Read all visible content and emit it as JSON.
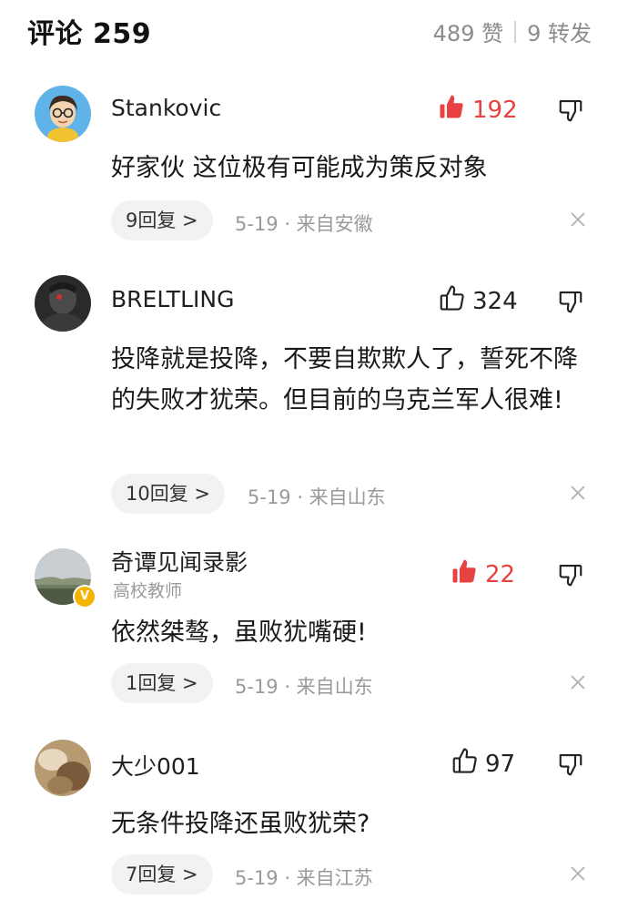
{
  "header": {
    "title": "评论 259",
    "likes": "489 赞",
    "forwards": "9 转发"
  },
  "colors": {
    "liked": "#e84142",
    "muted": "#9a9a9a",
    "pill_bg": "#f2f2f2",
    "verified_badge": "#f5b400"
  },
  "comments": [
    {
      "username": "Stankovic",
      "subtitle": "",
      "liked": true,
      "like_count": "192",
      "text": "好家伙 这位极有可能成为策反对象",
      "replies": "9回复 >",
      "meta": "5-19 · 来自安徽",
      "avatar_icon": "cartoon-avatar-icon"
    },
    {
      "username": "BRELTLING",
      "subtitle": "",
      "liked": false,
      "like_count": "324",
      "text": "投降就是投降，不要自欺欺人了，誓死不降的失败才犹荣。但目前的乌克兰军人很难!",
      "replies": "10回复 >",
      "meta": "5-19 · 来自山东",
      "avatar_icon": "dark-figure-avatar-icon"
    },
    {
      "username": "奇谭见闻录影",
      "subtitle": "高校教师",
      "liked": true,
      "like_count": "22",
      "text": "依然桀骜，虽败犹嘴硬!",
      "replies": "1回复 >",
      "meta": "5-19 · 来自山东",
      "avatar_icon": "landscape-avatar-icon",
      "verified_label": "V"
    },
    {
      "username": "大少001",
      "subtitle": "",
      "liked": false,
      "like_count": "97",
      "text": "无条件投降还虽败犹荣?",
      "replies": "7回复 >",
      "meta": "5-19 · 来自江苏",
      "avatar_icon": "photo-avatar-icon"
    }
  ]
}
